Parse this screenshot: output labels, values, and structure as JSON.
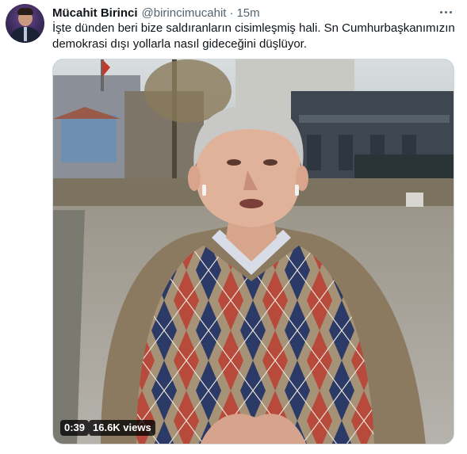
{
  "tweet": {
    "display_name": "Mücahit Birinci",
    "handle": "@birincimucahit",
    "separator": "·",
    "time": "15m",
    "text_line1": "İşte dünden beri bize saldıranların cisimleşmiş hali. Sn Cumhurbaşkanımızın",
    "text_line2": "demokrasi dışı yollarla nasıl gideceğini düşlüyor.",
    "more_icon": "more-horizontal-icon"
  },
  "video": {
    "duration": "0:39",
    "views": "16.6K views"
  },
  "colors": {
    "text_primary": "#0f1419",
    "text_secondary": "#536471",
    "border": "#cfd9de",
    "badge_bg": "#000000"
  }
}
